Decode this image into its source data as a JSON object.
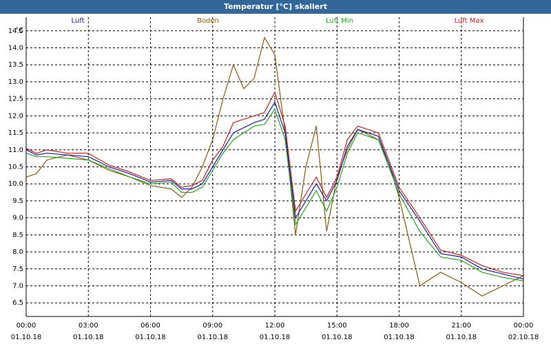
{
  "window": {
    "title": "Temperatur [°C] skaliert"
  },
  "colors": {
    "titlebar": "#336699",
    "grid": "#000000",
    "Luft": "#1a1aa8",
    "Boden": "#8b5a0a",
    "Luft Min": "#1fa81f",
    "Luft Max": "#c81e1e",
    "line_teal": "#1aa0a0"
  },
  "chart_data": {
    "type": "line",
    "ylabel": "°C",
    "ylim": [
      6.1,
      14.9
    ],
    "yticks": [
      6.5,
      7.0,
      7.5,
      8.0,
      8.5,
      9.0,
      9.5,
      10.0,
      10.5,
      11.0,
      11.5,
      12.0,
      12.5,
      13.0,
      13.5,
      14.0,
      14.5
    ],
    "xlim_hours": [
      0,
      24
    ],
    "xticks": [
      {
        "time": "00:00",
        "date": "01.10.18"
      },
      {
        "time": "03:00",
        "date": "01.10.18"
      },
      {
        "time": "06:00",
        "date": "01.10.18"
      },
      {
        "time": "09:00",
        "date": "01.10.18"
      },
      {
        "time": "12:00",
        "date": "01.10.18"
      },
      {
        "time": "15:00",
        "date": "01.10.18"
      },
      {
        "time": "18:00",
        "date": "01.10.18"
      },
      {
        "time": "21:00",
        "date": "01.10.18"
      },
      {
        "time": "00:00",
        "date": "02.10.18"
      }
    ],
    "grid": true,
    "legend_placement": "top",
    "series": [
      {
        "name": "Luft",
        "points": [
          [
            0,
            11.0
          ],
          [
            0.5,
            10.85
          ],
          [
            1.0,
            10.9
          ],
          [
            2.0,
            10.85
          ],
          [
            3.0,
            10.8
          ],
          [
            4.0,
            10.5
          ],
          [
            5.0,
            10.3
          ],
          [
            6.0,
            10.05
          ],
          [
            7.0,
            10.1
          ],
          [
            7.5,
            9.85
          ],
          [
            8.0,
            9.85
          ],
          [
            8.5,
            10.0
          ],
          [
            9.0,
            10.5
          ],
          [
            9.5,
            11.0
          ],
          [
            10.0,
            11.5
          ],
          [
            11.0,
            11.8
          ],
          [
            11.5,
            11.9
          ],
          [
            12.0,
            12.4
          ],
          [
            12.5,
            11.5
          ],
          [
            13.0,
            9.0
          ],
          [
            13.5,
            9.5
          ],
          [
            14.0,
            10.0
          ],
          [
            14.5,
            9.5
          ],
          [
            15.0,
            10.1
          ],
          [
            15.5,
            11.1
          ],
          [
            16.0,
            11.6
          ],
          [
            17.0,
            11.4
          ],
          [
            17.5,
            10.6
          ],
          [
            18.0,
            9.8
          ],
          [
            19.0,
            8.9
          ],
          [
            20.0,
            7.95
          ],
          [
            21.0,
            7.85
          ],
          [
            22.0,
            7.5
          ],
          [
            23.0,
            7.35
          ],
          [
            24.0,
            7.2
          ]
        ]
      },
      {
        "name": "Boden",
        "points": [
          [
            0,
            10.2
          ],
          [
            0.5,
            10.3
          ],
          [
            1.0,
            10.7
          ],
          [
            2.0,
            10.85
          ],
          [
            3.0,
            10.7
          ],
          [
            4.0,
            10.4
          ],
          [
            5.0,
            10.2
          ],
          [
            6.0,
            9.95
          ],
          [
            7.0,
            9.85
          ],
          [
            7.5,
            9.6
          ],
          [
            8.0,
            9.9
          ],
          [
            8.5,
            10.5
          ],
          [
            9.0,
            11.3
          ],
          [
            9.5,
            12.5
          ],
          [
            10.0,
            13.5
          ],
          [
            10.5,
            12.8
          ],
          [
            11.0,
            13.1
          ],
          [
            11.5,
            14.3
          ],
          [
            12.0,
            13.8
          ],
          [
            12.5,
            11.5
          ],
          [
            13.0,
            8.5
          ],
          [
            13.5,
            10.5
          ],
          [
            14.0,
            11.7
          ],
          [
            14.5,
            8.6
          ],
          [
            15.0,
            10.2
          ],
          [
            15.5,
            11.0
          ],
          [
            16.0,
            11.6
          ],
          [
            17.0,
            11.3
          ],
          [
            17.5,
            10.6
          ],
          [
            18.0,
            9.6
          ],
          [
            19.0,
            7.0
          ],
          [
            20.0,
            7.4
          ],
          [
            21.0,
            7.1
          ],
          [
            22.0,
            6.7
          ],
          [
            23.0,
            7.0
          ],
          [
            24.0,
            7.3
          ]
        ]
      },
      {
        "name": "Luft Min",
        "points": [
          [
            0,
            10.9
          ],
          [
            0.5,
            10.8
          ],
          [
            1.0,
            10.8
          ],
          [
            2.0,
            10.75
          ],
          [
            3.0,
            10.7
          ],
          [
            4.0,
            10.45
          ],
          [
            5.0,
            10.2
          ],
          [
            6.0,
            10.0
          ],
          [
            7.0,
            10.05
          ],
          [
            7.5,
            9.75
          ],
          [
            8.0,
            9.75
          ],
          [
            8.5,
            9.9
          ],
          [
            9.0,
            10.4
          ],
          [
            9.5,
            10.9
          ],
          [
            10.0,
            11.3
          ],
          [
            11.0,
            11.7
          ],
          [
            11.5,
            11.75
          ],
          [
            12.0,
            12.2
          ],
          [
            12.5,
            11.3
          ],
          [
            13.0,
            8.8
          ],
          [
            13.5,
            9.3
          ],
          [
            14.0,
            9.8
          ],
          [
            14.5,
            9.2
          ],
          [
            15.0,
            9.9
          ],
          [
            15.5,
            10.9
          ],
          [
            16.0,
            11.5
          ],
          [
            17.0,
            11.3
          ],
          [
            17.5,
            10.5
          ],
          [
            18.0,
            9.7
          ],
          [
            19.0,
            8.6
          ],
          [
            20.0,
            7.85
          ],
          [
            21.0,
            7.75
          ],
          [
            22.0,
            7.4
          ],
          [
            23.0,
            7.25
          ],
          [
            24.0,
            7.15
          ]
        ]
      },
      {
        "name": "Luft Max",
        "points": [
          [
            0,
            11.05
          ],
          [
            0.5,
            10.9
          ],
          [
            1.0,
            11.0
          ],
          [
            2.0,
            10.9
          ],
          [
            3.0,
            10.9
          ],
          [
            4.0,
            10.55
          ],
          [
            5.0,
            10.35
          ],
          [
            6.0,
            10.1
          ],
          [
            7.0,
            10.15
          ],
          [
            7.5,
            9.9
          ],
          [
            8.0,
            9.95
          ],
          [
            8.5,
            10.1
          ],
          [
            9.0,
            10.7
          ],
          [
            9.5,
            11.1
          ],
          [
            10.0,
            11.8
          ],
          [
            11.0,
            12.0
          ],
          [
            11.5,
            12.1
          ],
          [
            12.0,
            12.7
          ],
          [
            12.5,
            11.7
          ],
          [
            13.0,
            9.2
          ],
          [
            13.5,
            9.7
          ],
          [
            14.0,
            10.2
          ],
          [
            14.5,
            9.6
          ],
          [
            15.0,
            10.2
          ],
          [
            15.5,
            11.3
          ],
          [
            16.0,
            11.7
          ],
          [
            17.0,
            11.5
          ],
          [
            17.5,
            10.7
          ],
          [
            18.0,
            9.9
          ],
          [
            19.0,
            9.0
          ],
          [
            20.0,
            8.05
          ],
          [
            21.0,
            7.9
          ],
          [
            22.0,
            7.6
          ],
          [
            23.0,
            7.4
          ],
          [
            24.0,
            7.3
          ]
        ]
      }
    ]
  }
}
